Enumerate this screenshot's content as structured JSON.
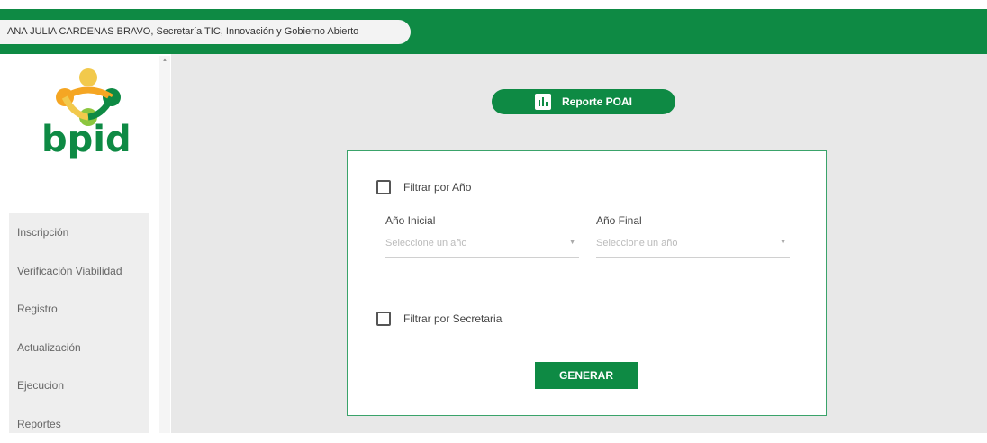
{
  "header": {
    "user": "ANA JULIA CARDENAS BRAVO, Secretaría TIC, Innovación y Gobierno Abierto"
  },
  "logo": {
    "text": "bpid"
  },
  "sidebar": {
    "items": [
      {
        "label": "Inscripción"
      },
      {
        "label": "Verificación Viabilidad"
      },
      {
        "label": "Registro"
      },
      {
        "label": "Actualización"
      },
      {
        "label": "Ejecucion"
      },
      {
        "label": "Reportes"
      }
    ]
  },
  "main": {
    "report_button": "Reporte POAI",
    "form": {
      "filter_year": {
        "label": "Filtrar por Año",
        "checked": false
      },
      "start_year": {
        "label": "Año Inicial",
        "placeholder": "Seleccione un año"
      },
      "end_year": {
        "label": "Año Final",
        "placeholder": "Seleccione un año"
      },
      "filter_secretary": {
        "label": "Filtrar por Secretaria",
        "checked": false
      },
      "generate_button": "GENERAR"
    }
  },
  "colors": {
    "brand_green": "#0e8a44",
    "logo_orange": "#f5a623",
    "logo_yellow": "#f2c94c",
    "logo_light_green": "#8cc63f"
  },
  "icons": [
    "chart-icon",
    "checkbox-icon",
    "dropdown-caret-icon",
    "scroll-up-icon"
  ]
}
